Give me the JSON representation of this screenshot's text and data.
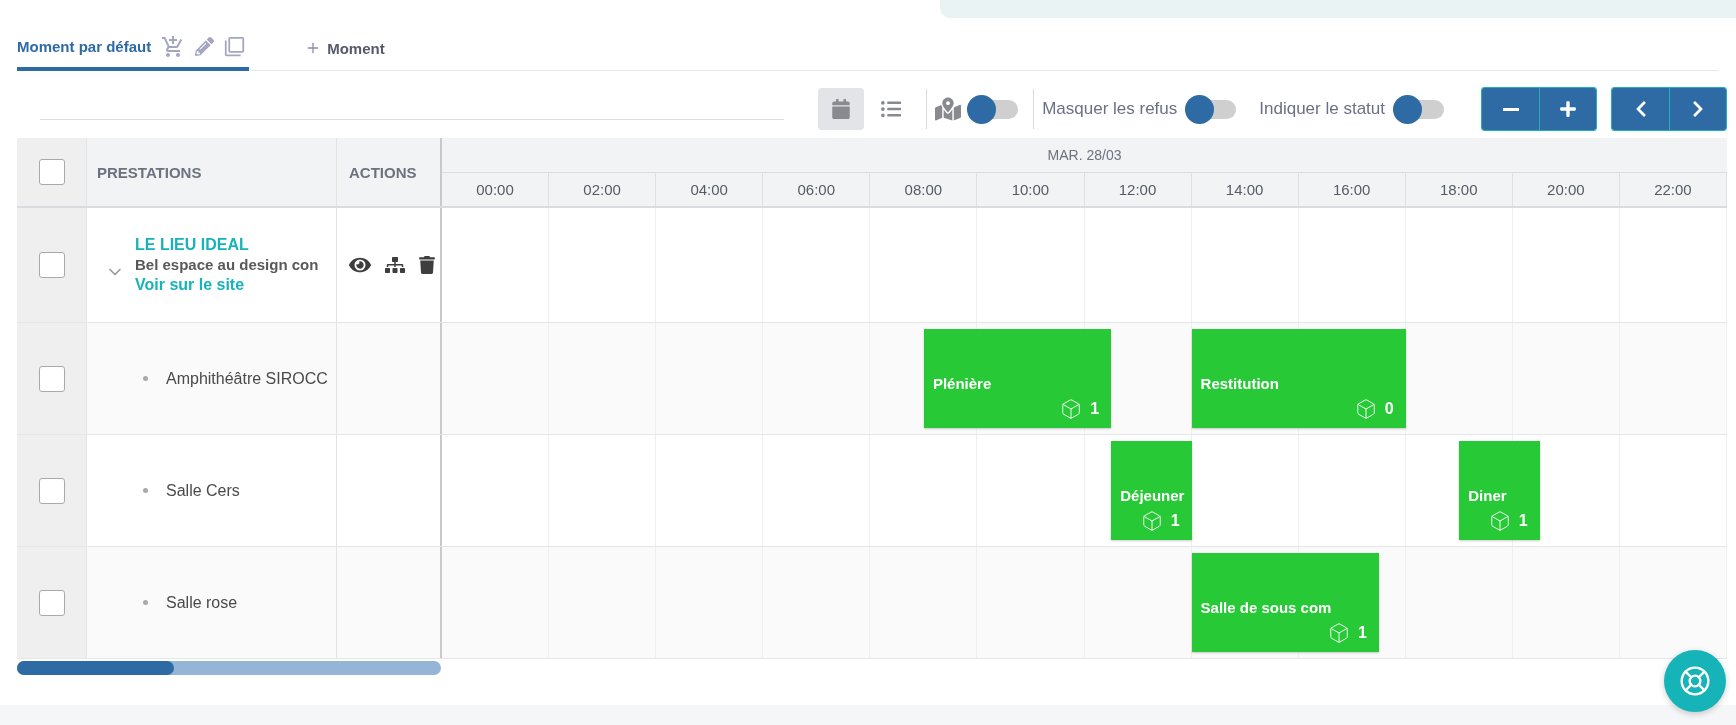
{
  "tabs": [
    {
      "label": "Moment par défaut",
      "selected": true,
      "kind": "moment"
    },
    {
      "label": "Moment",
      "selected": false,
      "kind": "add"
    }
  ],
  "toolbar": {
    "views": [
      {
        "kind": "calendar",
        "selected": true
      },
      {
        "kind": "list",
        "selected": false
      }
    ],
    "map_toggle": {
      "on": false
    },
    "toggles": [
      {
        "label": "Masquer les refus",
        "on": false
      },
      {
        "label": "Indiquer le statut",
        "on": false
      }
    ],
    "zoom_buttons": [
      {
        "kind": "minus"
      },
      {
        "kind": "plus"
      }
    ],
    "nav_buttons": [
      {
        "kind": "prev"
      },
      {
        "kind": "next"
      }
    ]
  },
  "table": {
    "columns": [
      "PRESTATIONS",
      "ACTIONS"
    ],
    "select_all": {
      "checked": false
    },
    "date": "MAR. 28/03",
    "hours": [
      "00:00",
      "02:00",
      "04:00",
      "06:00",
      "08:00",
      "10:00",
      "12:00",
      "14:00",
      "16:00",
      "18:00",
      "20:00",
      "22:00"
    ],
    "rows": [
      {
        "kind": "group",
        "checked": false,
        "expanded": true,
        "title": "LE LIEU IDEAL",
        "description": "Bel espace au design con",
        "link": "Voir sur le site",
        "events": []
      },
      {
        "kind": "item",
        "checked": false,
        "name": "Amphithéâtre SIROCC",
        "events": [
          {
            "title": "Plénière",
            "count": "1"
          },
          {
            "title": "Restitution",
            "count": "0"
          }
        ]
      },
      {
        "kind": "item",
        "checked": false,
        "name": "Salle Cers",
        "events": [
          {
            "title": "Déjeuner",
            "count": "1"
          },
          {
            "title": "Diner",
            "count": "1"
          }
        ]
      },
      {
        "kind": "item",
        "checked": false,
        "name": "Salle rose",
        "events": [
          {
            "title": "Salle de sous com",
            "count": "1"
          }
        ]
      }
    ],
    "scroll": {
      "level": 0.37
    }
  }
}
